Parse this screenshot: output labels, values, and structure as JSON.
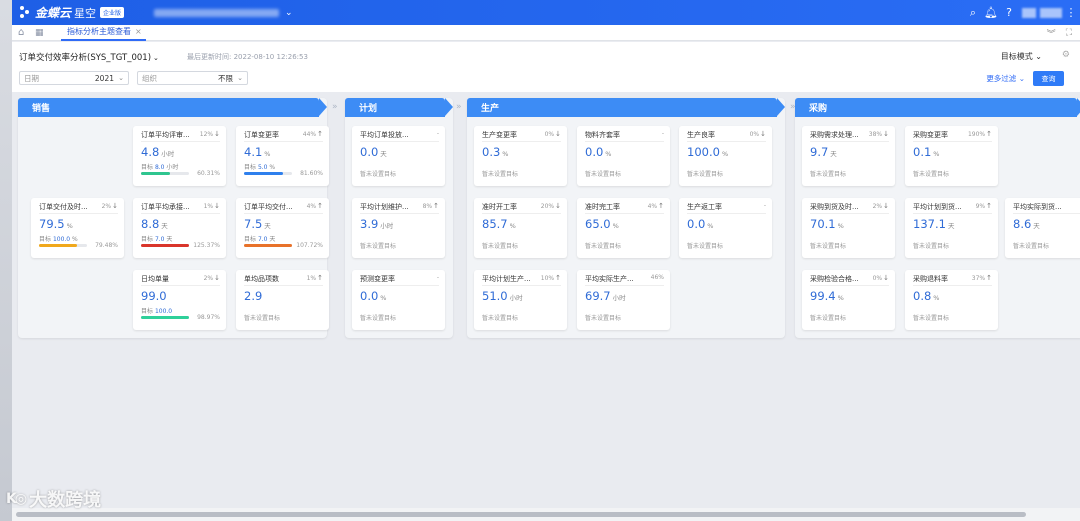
{
  "app": {
    "brand": "金蝶云",
    "brand_sub": "星空",
    "edition_badge": "企业版"
  },
  "tabs": [
    {
      "label": "指标分析主题查看"
    }
  ],
  "header": {
    "report_title": "订单交付效率分析(SYS_TGT_001)",
    "updated_label": "最后更新时间: 2022-08-10 12:26:53",
    "mode": "目标模式",
    "filters": [
      {
        "label": "日期",
        "value": "2021"
      },
      {
        "label": "组织",
        "value": "不限"
      }
    ],
    "more_filter": "更多过滤",
    "query": "查询"
  },
  "panels": [
    {
      "title": "销售",
      "cards": [
        {
          "name": "订单交付及时...",
          "pct": "2%",
          "trend": "down",
          "value": "79.5",
          "unit": "%",
          "target_label": "目标",
          "target": "100.0",
          "target_unit": "%",
          "ratio": "79.48%",
          "progress": 0.79,
          "color": "#f0a81c"
        },
        {
          "name": "订单平均评审...",
          "pct": "12%",
          "trend": "down",
          "value": "4.8",
          "unit": "小时",
          "target_label": "目标",
          "target": "8.0",
          "target_unit": "小时",
          "ratio": "60.31%",
          "progress": 0.6,
          "color": "#2fc58f"
        },
        {
          "name": "订单变更率",
          "pct": "44%",
          "trend": "up",
          "value": "4.1",
          "unit": "%",
          "target_label": "目标",
          "target": "5.0",
          "target_unit": "%",
          "ratio": "81.60%",
          "progress": 0.82,
          "color": "#2f80ed"
        },
        {
          "name": "订单平均承接...",
          "pct": "1%",
          "trend": "down",
          "value": "8.8",
          "unit": "天",
          "target_label": "目标",
          "target": "7.0",
          "target_unit": "天",
          "ratio": "125.37%",
          "progress": 1.0,
          "color": "#d9352b"
        },
        {
          "name": "订单平均交付...",
          "pct": "4%",
          "trend": "up",
          "value": "7.5",
          "unit": "天",
          "target_label": "目标",
          "target": "7.0",
          "target_unit": "天",
          "ratio": "107.72%",
          "progress": 1.0,
          "color": "#e8722a"
        },
        {
          "name": "日均单量",
          "pct": "2%",
          "trend": "down",
          "value": "99.0",
          "unit": "",
          "target_label": "目标",
          "target": "100.0",
          "target_unit": "",
          "ratio": "98.97%",
          "progress": 0.99,
          "color": "#2fd09a"
        },
        {
          "name": "单均品项数",
          "pct": "1%",
          "trend": "up",
          "value": "2.9",
          "unit": "",
          "noset": "暂未设置目标"
        }
      ]
    },
    {
      "title": "计划",
      "cards": [
        {
          "name": "平均订单投放...",
          "pct": "-",
          "value": "0.0",
          "unit": "天",
          "noset": "暂未设置目标"
        },
        {
          "name": "平均计划维护...",
          "pct": "8%",
          "trend": "up",
          "value": "3.9",
          "unit": "小时",
          "noset": "暂未设置目标"
        },
        {
          "name": "预测变更率",
          "pct": "-",
          "value": "0.0",
          "unit": "%",
          "noset": "暂未设置目标"
        }
      ]
    },
    {
      "title": "生产",
      "cards": [
        {
          "name": "生产变更率",
          "pct": "0%",
          "trend": "down",
          "value": "0.3",
          "unit": "%",
          "noset": "暂未设置目标"
        },
        {
          "name": "物料齐套率",
          "pct": "-",
          "value": "0.0",
          "unit": "%",
          "noset": "暂未设置目标"
        },
        {
          "name": "生产良率",
          "pct": "0%",
          "trend": "down",
          "value": "100.0",
          "unit": "%",
          "noset": "暂未设置目标"
        },
        {
          "name": "准时开工率",
          "pct": "20%",
          "trend": "down",
          "value": "85.7",
          "unit": "%",
          "noset": "暂未设置目标"
        },
        {
          "name": "准时完工率",
          "pct": "4%",
          "trend": "up",
          "value": "65.0",
          "unit": "%",
          "noset": "暂未设置目标"
        },
        {
          "name": "生产返工率",
          "pct": "-",
          "value": "0.0",
          "unit": "%",
          "noset": "暂未设置目标"
        },
        {
          "name": "平均计划生产...",
          "pct": "10%",
          "trend": "up",
          "value": "51.0",
          "unit": "小时",
          "noset": "暂未设置目标"
        },
        {
          "name": "平均实际生产...",
          "pct": "46%",
          "trend": "",
          "value": "69.7",
          "unit": "小时",
          "noset": "暂未设置目标"
        }
      ]
    },
    {
      "title": "采购",
      "cards": [
        {
          "name": "采购需求处理...",
          "pct": "38%",
          "trend": "down",
          "value": "9.7",
          "unit": "天",
          "noset": "暂未设置目标"
        },
        {
          "name": "采购变更率",
          "pct": "190%",
          "trend": "up",
          "value": "0.1",
          "unit": "%",
          "noset": "暂未设置目标"
        },
        {
          "name": "采购到货及时...",
          "pct": "2%",
          "trend": "down",
          "value": "70.1",
          "unit": "%",
          "noset": "暂未设置目标"
        },
        {
          "name": "平均计划到货...",
          "pct": "9%",
          "trend": "up",
          "value": "137.1",
          "unit": "天",
          "noset": "暂未设置目标"
        },
        {
          "name": "平均实际到货...",
          "pct": "",
          "trend": "",
          "value": "8.6",
          "unit": "天",
          "noset": "暂未设置目标"
        },
        {
          "name": "采购检验合格...",
          "pct": "0%",
          "trend": "down",
          "value": "99.4",
          "unit": "%",
          "noset": "暂未设置目标"
        },
        {
          "name": "采购退料率",
          "pct": "37%",
          "trend": "up",
          "value": "0.8",
          "unit": "%",
          "noset": "暂未设置目标"
        }
      ]
    }
  ],
  "watermark": "大数跨境"
}
